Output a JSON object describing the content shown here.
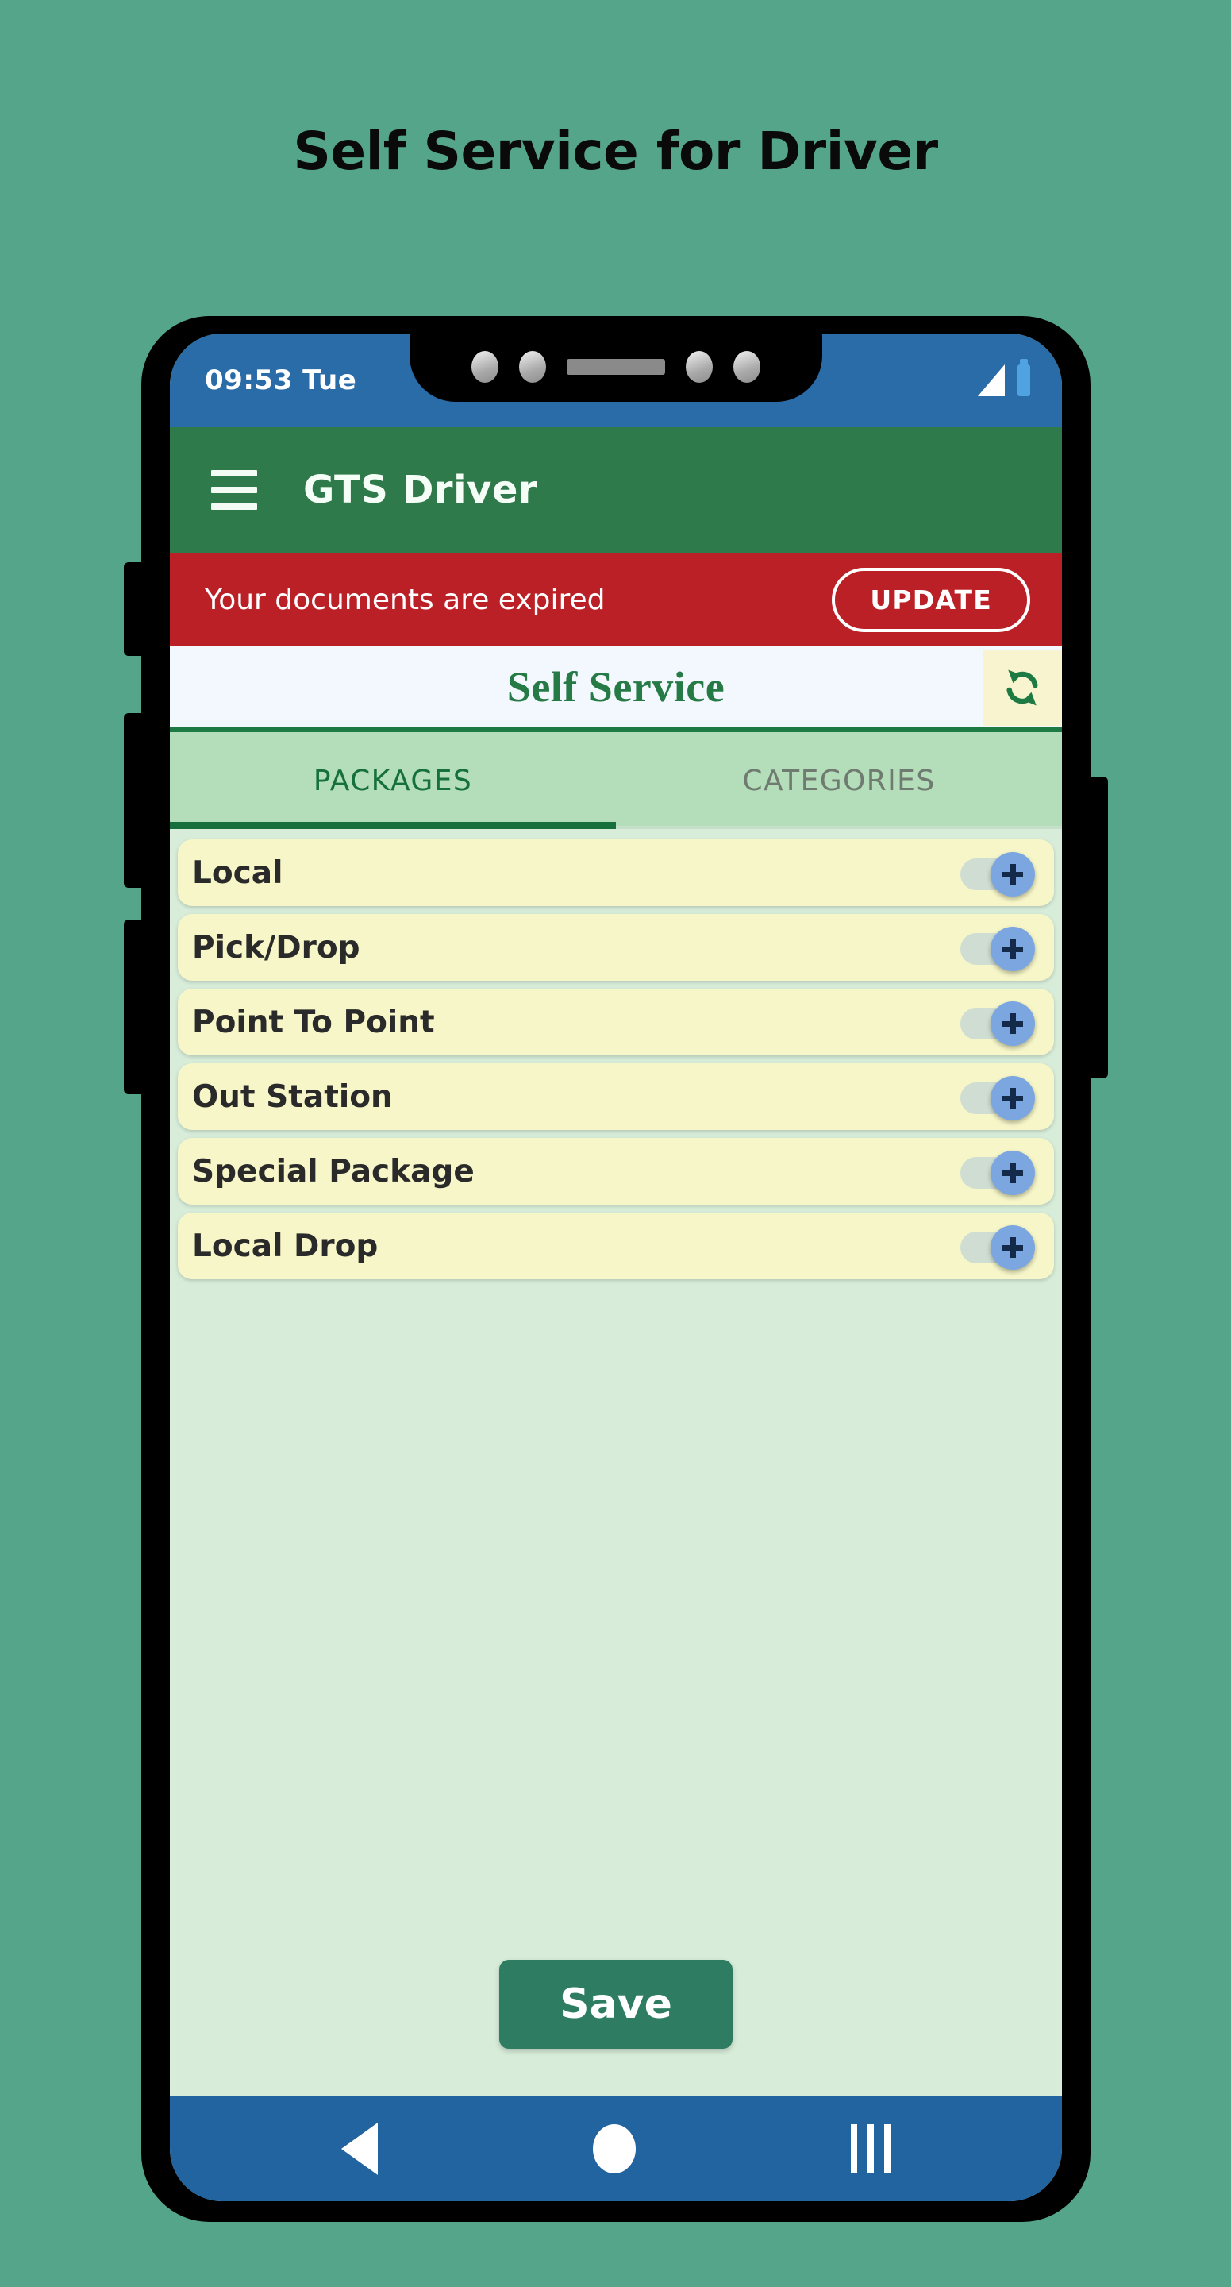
{
  "headline": "Self Service for Driver",
  "colors": {
    "page_background": "#55a58b",
    "appbar_green": "#2e7a4a",
    "alert_red": "#ba2025",
    "status_blue": "#2a6ca8",
    "nav_blue": "#2264a0",
    "tabs_green": "#b4ddb9",
    "list_background": "#d7ecd9",
    "row_yellow": "#f6f6c8",
    "save_green": "#2e7d63",
    "toggle_thumb_blue": "#7ba6e0",
    "accent_dark_green": "#15703c"
  },
  "statusbar": {
    "time": "09:53 Tue",
    "signal_icon": "signal-triangle-icon",
    "battery_icon": "battery-icon"
  },
  "appbar": {
    "menu_icon": "hamburger-menu-icon",
    "title": "GTS Driver"
  },
  "alert": {
    "message": "Your documents are expired",
    "button_label": "UPDATE"
  },
  "self_service": {
    "title": "Self Service",
    "refresh_icon": "refresh-sync-icon"
  },
  "tabs": [
    {
      "label": "PACKAGES",
      "active": true
    },
    {
      "label": "CATEGORIES",
      "active": false
    }
  ],
  "packages": [
    {
      "label": "Local",
      "toggle_icon": "plus-icon",
      "enabled": false
    },
    {
      "label": "Pick/Drop",
      "toggle_icon": "plus-icon",
      "enabled": false
    },
    {
      "label": "Point To Point",
      "toggle_icon": "plus-icon",
      "enabled": false
    },
    {
      "label": "Out Station",
      "toggle_icon": "plus-icon",
      "enabled": false
    },
    {
      "label": "Special Package",
      "toggle_icon": "plus-icon",
      "enabled": false
    },
    {
      "label": "Local Drop",
      "toggle_icon": "plus-icon",
      "enabled": false
    }
  ],
  "save": {
    "label": "Save"
  },
  "navbar": {
    "back_icon": "back-triangle-icon",
    "home_icon": "home-circle-icon",
    "recents_icon": "recents-bars-icon"
  }
}
